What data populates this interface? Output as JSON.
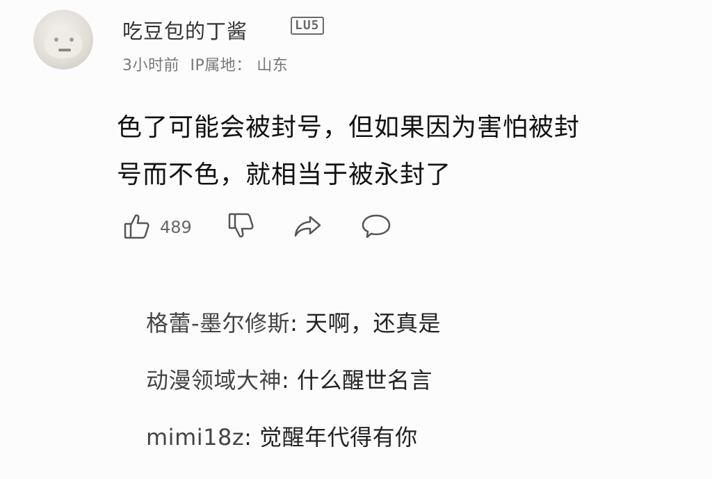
{
  "comment": {
    "author": "吃豆包的丁酱",
    "level_badge": "LU5",
    "time": "3小时前",
    "ip_label": "IP属地：",
    "ip_location": "山东",
    "text_line1": "色了可能会被封号，但如果因为害怕被封",
    "text_line2": "号而不色，就相当于被永封了",
    "like_count": "489",
    "icons": {
      "like": "thumbs-up-icon",
      "dislike": "thumbs-down-icon",
      "share": "share-icon",
      "reply": "comment-icon"
    }
  },
  "replies": [
    {
      "name": "格蕾-墨尔修斯",
      "text": "天啊，还真是"
    },
    {
      "name": "动漫领域大神",
      "text": "什么醒世名言"
    },
    {
      "name": "mimi18z",
      "text": "觉醒年代得有你"
    }
  ]
}
